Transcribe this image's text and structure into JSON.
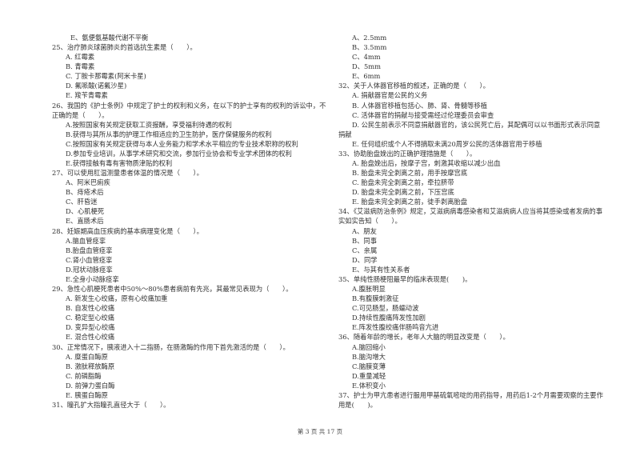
{
  "columns": [
    [
      {
        "type": "option",
        "text": "E、氨便氨基酸代谢不平衡"
      },
      {
        "type": "question",
        "text": "25、治疗肺炎球菌肺炎的首选抗生素是（　　）。"
      },
      {
        "type": "option",
        "text": "A. 红霉素"
      },
      {
        "type": "option",
        "text": "B. 青霉素"
      },
      {
        "type": "option",
        "text": "C. 丁胺卡那霉素(阿米卡星)"
      },
      {
        "type": "option",
        "text": "D. 氟哌酸(诺氟沙星)"
      },
      {
        "type": "option",
        "text": "E. 羧苄青霉素"
      },
      {
        "type": "question",
        "text": "26、我国的《护士条例》中规定了护士的权利和义务，在以下的护士享有的权利的诉讼中，不正确的是（　　）。"
      },
      {
        "type": "option",
        "text": "A.按照国家有关规定获取工资报酬，享受福利待遇的权利"
      },
      {
        "type": "option",
        "text": "B.获得与其所从事的护理工作相适应的卫生防护，医疗保健服务的权利"
      },
      {
        "type": "option",
        "text": "C.按照国家有关规定获得与本人业务能力和学术水平相应的专业技术职称的权利"
      },
      {
        "type": "option",
        "text": "D.参加专业培训，从事学术研究和交流，参加行业协会和专业学术团体的权利"
      },
      {
        "type": "option",
        "text": "E.获得接触有毒有害物质津贴的权利"
      },
      {
        "type": "question",
        "text": "27、可以使用肛温测量患者体温的情况是（　　）。"
      },
      {
        "type": "option",
        "text": "A、阿米巴痢疾"
      },
      {
        "type": "option",
        "text": "B、痔疮术后"
      },
      {
        "type": "option",
        "text": "C、肝昏迷"
      },
      {
        "type": "option",
        "text": "D、心肌梗死"
      },
      {
        "type": "option",
        "text": "E、直肠术后"
      },
      {
        "type": "question",
        "text": "28、妊娠期高血压疾病的基本病理变化是（　　）。"
      },
      {
        "type": "option",
        "text": "A.脑血管痉挛"
      },
      {
        "type": "option",
        "text": "B.胎盘血管痉挛"
      },
      {
        "type": "option",
        "text": "C.肾小血管痉挛"
      },
      {
        "type": "option",
        "text": "D.冠状动脉痉挛"
      },
      {
        "type": "option",
        "text": "E.全身小动脉痉挛"
      },
      {
        "type": "question",
        "text": "29、急性心肌梗死患者中50%～80%患者病前有先兆，其最常见表现为（　　）。"
      },
      {
        "type": "option",
        "text": "A. 新发生心绞痛，原有心绞痛加重"
      },
      {
        "type": "option",
        "text": "B. 自发性心绞痛"
      },
      {
        "type": "option",
        "text": "C. 稳定型心绞痛"
      },
      {
        "type": "option",
        "text": "D. 变异型心绞痛"
      },
      {
        "type": "option",
        "text": "E. 混合性心绞痛"
      },
      {
        "type": "question",
        "text": "30、正常情况下，胰液进入十二指肠，在肠激酶的作用下首先激活的是（　　）。"
      },
      {
        "type": "option",
        "text": "A. 糜蛋白酶原"
      },
      {
        "type": "option",
        "text": "B. 激肽释放酶原"
      },
      {
        "type": "option",
        "text": "C. 前磷脂酶"
      },
      {
        "type": "option",
        "text": "D. 前弹力蛋白酶"
      },
      {
        "type": "option",
        "text": "E. 胰蛋白酶原"
      },
      {
        "type": "question",
        "text": "31、瞳孔扩大指瞳孔直径大于（　　）。"
      }
    ],
    [
      {
        "type": "option",
        "text": "A、2.5mm"
      },
      {
        "type": "option",
        "text": "B、3.5mm"
      },
      {
        "type": "option",
        "text": "C、4mm"
      },
      {
        "type": "option",
        "text": "D、5mm"
      },
      {
        "type": "option",
        "text": "E、6mm"
      },
      {
        "type": "question",
        "text": "32、关于人体器官移植的叙述，正确的是（　　）。"
      },
      {
        "type": "option",
        "text": "A. 捐献器官是公民的义务"
      },
      {
        "type": "option",
        "text": "B. 人体器官移植包括心、肺、肾、骨髓等移植"
      },
      {
        "type": "option",
        "text": "C. 活体器官的捐献与接受需经过伦理委员会审查"
      },
      {
        "type": "option",
        "text": "D. 公民生前表示不同意捐献器官的，该公民死亡后，其配偶可以以书面形式表示同意捐献"
      },
      {
        "type": "option",
        "text": "E. 任何组织或个人不得摘取未满20周岁公民的活体器官用于移植"
      },
      {
        "type": "question",
        "text": "33、协助胎盘娩出的正确护理措施是（　　）。"
      },
      {
        "type": "option",
        "text": "A. 胎盘娩出后，按摩子宫，刺激其收缩以减少出血"
      },
      {
        "type": "option",
        "text": "B. 胎盘未完全剥离之前，用手按摩宫底"
      },
      {
        "type": "option",
        "text": "C. 胎盘未完全剥离之前，牵拉脐带"
      },
      {
        "type": "option",
        "text": "D. 胎盘未完全剥离之前，下压宫底"
      },
      {
        "type": "option",
        "text": "E. 胎盘未完全剥离之前，徒手剥离胎盘"
      },
      {
        "type": "question",
        "text": "34、《艾滋病防治条例》规定，艾滋病病毒感染者和艾滋病病人应当将其感染或者发病的事实如实告知（　　）。"
      },
      {
        "type": "option",
        "text": "A、朋友"
      },
      {
        "type": "option",
        "text": "B、同事"
      },
      {
        "type": "option",
        "text": "C、亲属"
      },
      {
        "type": "option",
        "text": "D、同学"
      },
      {
        "type": "option",
        "text": "E、与其有性关系者"
      },
      {
        "type": "question",
        "text": "35、单纯性肠梗阻最早的临床表现是(　　)。"
      },
      {
        "type": "option",
        "text": "A.腹胀明显"
      },
      {
        "type": "option",
        "text": "B.有腹膜刺激征"
      },
      {
        "type": "option",
        "text": "C.可见肠型，肠蠕动波"
      },
      {
        "type": "option",
        "text": "D.持续性腹痛阵发性加剧"
      },
      {
        "type": "option",
        "text": "E.阵发性腹绞痛伴肠鸣音亢进"
      },
      {
        "type": "question",
        "text": "36、随着年龄的增长，老年人大脑的明显改变是（　　）。"
      },
      {
        "type": "option",
        "text": "A.脑回缩小"
      },
      {
        "type": "option",
        "text": "B.脑沟增大"
      },
      {
        "type": "option",
        "text": "C.脑膜变薄"
      },
      {
        "type": "option",
        "text": "D.重量减轻"
      },
      {
        "type": "option",
        "text": "E.体积变小"
      },
      {
        "type": "question",
        "text": "37、护士为甲亢患者进行服用甲基硫氧嘧啶的用药指导，用药后1-2个月需要观察的主要作用是(　　)。"
      }
    ]
  ],
  "footer": {
    "page_label": "第 3 页 共 17 页"
  }
}
